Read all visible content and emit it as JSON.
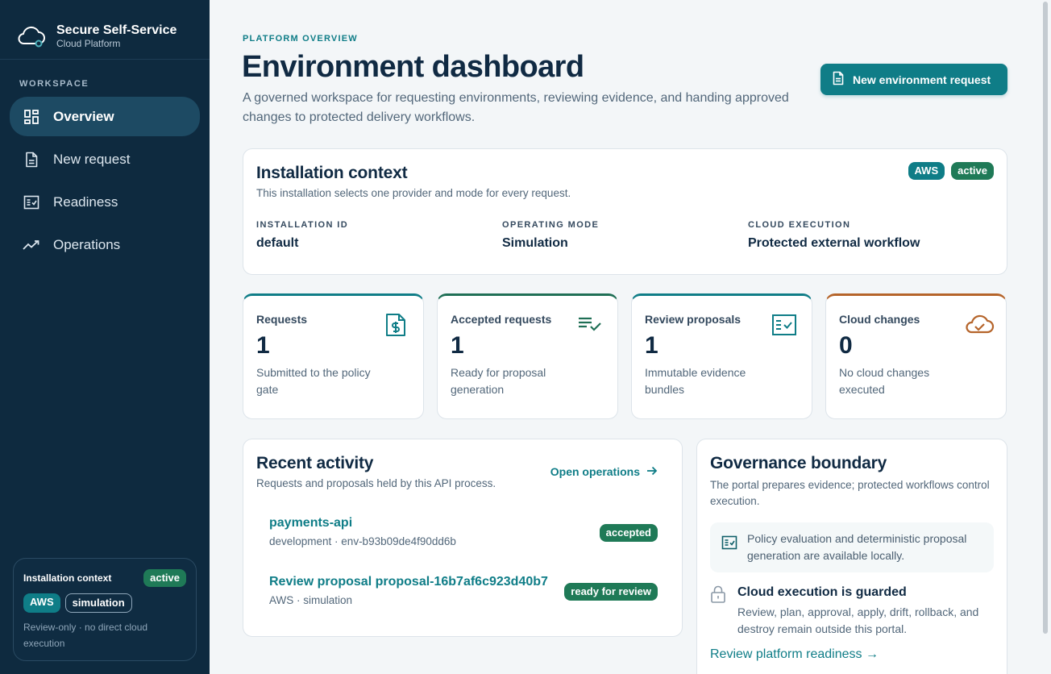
{
  "brand": {
    "title": "Secure Self-Service",
    "subtitle": "Cloud Platform",
    "icon": "cloud-icon"
  },
  "sidebar": {
    "section_label": "WORKSPACE",
    "items": [
      {
        "label": "Overview",
        "icon": "dashboard-icon",
        "active": true
      },
      {
        "label": "New request",
        "icon": "document-icon",
        "active": false
      },
      {
        "label": "Readiness",
        "icon": "checklist-icon",
        "active": false
      },
      {
        "label": "Operations",
        "icon": "trend-icon",
        "active": false
      }
    ],
    "context": {
      "title": "Installation context",
      "status": "active",
      "provider": "AWS",
      "mode": "simulation",
      "note": "Review-only · no direct cloud execution"
    }
  },
  "header": {
    "eyebrow": "PLATFORM OVERVIEW",
    "title": "Environment dashboard",
    "description": "A governed workspace for requesting environments, reviewing evidence, and handing approved changes to protected delivery workflows.",
    "primary_button": "New environment request"
  },
  "installation": {
    "title": "Installation context",
    "subtitle": "This installation selects one provider and mode for every request.",
    "badges": [
      "AWS",
      "active"
    ],
    "fields": [
      {
        "label": "INSTALLATION ID",
        "value": "default"
      },
      {
        "label": "OPERATING MODE",
        "value": "Simulation"
      },
      {
        "label": "CLOUD EXECUTION",
        "value": "Protected external workflow"
      }
    ]
  },
  "stats": [
    {
      "label": "Requests",
      "value": "1",
      "desc": "Submitted to the policy gate",
      "icon": "invoice-icon",
      "accent": "#0f7d87"
    },
    {
      "label": "Accepted requests",
      "value": "1",
      "desc": "Ready for proposal generation",
      "icon": "list-check-icon",
      "accent": "#1f6f55"
    },
    {
      "label": "Review proposals",
      "value": "1",
      "desc": "Immutable evidence bundles",
      "icon": "checklist-icon",
      "accent": "#0f7d87"
    },
    {
      "label": "Cloud changes",
      "value": "0",
      "desc": "No cloud changes executed",
      "icon": "cloud-check-icon",
      "accent": "#b5642a"
    }
  ],
  "activity": {
    "title": "Recent activity",
    "subtitle": "Requests and proposals held by this API process.",
    "link": "Open operations",
    "items": [
      {
        "name": "payments-api",
        "meta": "development · env-b93b09de4f90dd6b",
        "status": "accepted"
      },
      {
        "name": "Review proposal proposal-16b7af6c923d40b7",
        "meta": "AWS · simulation",
        "status": "ready for review"
      }
    ]
  },
  "governance": {
    "title": "Governance boundary",
    "subtitle": "The portal prepares evidence; protected workflows control execution.",
    "note": "Policy evaluation and deterministic proposal generation are available locally.",
    "guard_title": "Cloud execution is guarded",
    "guard_text": "Review, plan, approval, apply, drift, rollback, and destroy remain outside this portal.",
    "link": "Review platform readiness →"
  }
}
